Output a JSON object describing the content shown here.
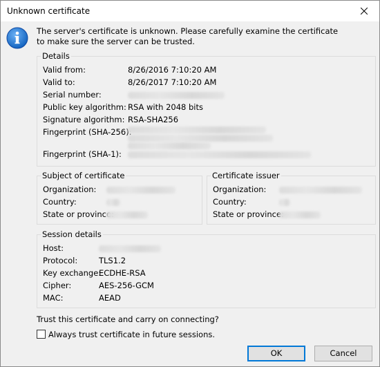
{
  "window": {
    "title": "Unknown certificate"
  },
  "message": {
    "line1": "The server's certificate is unknown. Please carefully examine the certificate",
    "line2": "to make sure the server can be trusted."
  },
  "details": {
    "legend": "Details",
    "valid_from_label": "Valid from:",
    "valid_from": "8/26/2016 7:10:20 AM",
    "valid_to_label": "Valid to:",
    "valid_to": "8/26/2017 7:10:20 AM",
    "serial_label": "Serial number:",
    "pubkey_label": "Public key algorithm:",
    "pubkey": "RSA with 2048 bits",
    "sigalg_label": "Signature algorithm:",
    "sigalg": "RSA-SHA256",
    "fp256_label": "Fingerprint (SHA-256):",
    "fp1_label": "Fingerprint (SHA-1):"
  },
  "subject": {
    "legend": "Subject of certificate",
    "org_label": "Organization:",
    "country_label": "Country:",
    "state_label": "State or province:"
  },
  "issuer": {
    "legend": "Certificate issuer",
    "org_label": "Organization:",
    "country_label": "Country:",
    "state_label": "State or province:"
  },
  "session": {
    "legend": "Session details",
    "host_label": "Host:",
    "protocol_label": "Protocol:",
    "protocol": "TLS1.2",
    "kex_label": "Key exchange:",
    "kex": "ECDHE-RSA",
    "cipher_label": "Cipher:",
    "cipher": "AES-256-GCM",
    "mac_label": "MAC:",
    "mac": "AEAD"
  },
  "trust_question": "Trust this certificate and carry on connecting?",
  "always_trust_label": "Always trust certificate in future sessions.",
  "buttons": {
    "ok": "OK",
    "cancel": "Cancel"
  },
  "colors": {
    "info_icon": "#1565c0",
    "default_button_border": "#0078d7"
  }
}
